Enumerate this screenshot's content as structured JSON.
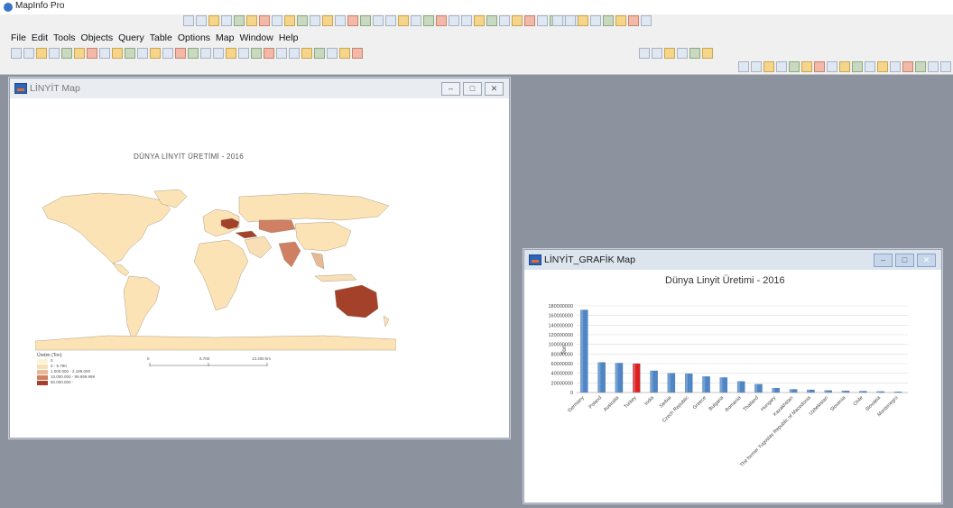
{
  "app": {
    "title": "MapInfo Pro"
  },
  "menu": [
    "File",
    "Edit",
    "Tools",
    "Objects",
    "Query",
    "Table",
    "Options",
    "Map",
    "Window",
    "Help"
  ],
  "map_window": {
    "title": "LİNYİT Map",
    "map_title": "DÜNYA LİNYİT ÜRETİMİ - 2016",
    "legend": {
      "title": "Üretim (Ton)",
      "items": [
        {
          "label": "0",
          "color": "#fdf2d6"
        },
        {
          "label": "0 - 5.790",
          "color": "#f8dfb6"
        },
        {
          "label": "1.000.000 - 2.199.000",
          "color": "#e8b995"
        },
        {
          "label": "10.000.000 - 99.999.999",
          "color": "#cf7f62"
        },
        {
          "label": "50.000.000 -",
          "color": "#a3412b"
        }
      ]
    },
    "scale": {
      "labels": [
        "0",
        "6.700",
        "13.400 km"
      ]
    }
  },
  "chart_window": {
    "title": "LİNYİT_GRAFİK Map",
    "chart_data": {
      "type": "bar",
      "title": "Dünya Linyit Üretimi - 2016",
      "ylabel": "Ton",
      "xlabel": "",
      "ylim": [
        0,
        180000000
      ],
      "yticks": [
        0,
        20000000,
        40000000,
        60000000,
        80000000,
        100000000,
        120000000,
        140000000,
        160000000,
        180000000
      ],
      "categories": [
        "Germany",
        "Poland",
        "Australia",
        "Turkey",
        "India",
        "Serbia",
        "Czech Republic",
        "Greece",
        "Bulgaria",
        "Romania",
        "Thailand",
        "Hungary",
        "Kazakhstan",
        "The former Yugoslav Republic of Macedonia",
        "Uzbekistan",
        "Slovenia",
        "Chile",
        "Slovakia",
        "Montenegro"
      ],
      "values": [
        171500000,
        62500000,
        61000000,
        60000000,
        45000000,
        40000000,
        39000000,
        33000000,
        31000000,
        23000000,
        17000000,
        9000000,
        6500000,
        5500000,
        4000000,
        3200000,
        2700000,
        2000000,
        1500000
      ],
      "bar_color": "#4f86c6",
      "highlight": {
        "category": "Turkey",
        "color": "#e02020"
      }
    }
  }
}
